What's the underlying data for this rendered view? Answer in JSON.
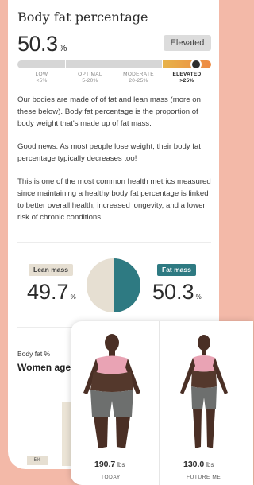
{
  "title": "Body fat percentage",
  "current": {
    "value": "50.3",
    "unit": "%",
    "status": "Elevated"
  },
  "scale": {
    "marker_fraction": 0.53,
    "ranges": [
      {
        "name": "LOW",
        "range": "<5%",
        "active": false
      },
      {
        "name": "OPTIMAL",
        "range": "5-20%",
        "active": false
      },
      {
        "name": "MODERATE",
        "range": "20-25%",
        "active": false
      },
      {
        "name": "ELEVATED",
        "range": ">25%",
        "active": true
      }
    ]
  },
  "paragraphs": [
    "Our bodies are made of of fat and lean mass (more on these below).  Body fat percentage is the proportion of body weight that's made up of fat mass.",
    "Good news: As most people lose weight, their body fat percentage typically decreases too!",
    "This is one of the most common health metrics measured since maintaining a healthy body fat percentage is linked to better overall health, increased longevity, and a lower risk of chronic conditions."
  ],
  "composition": {
    "lean": {
      "label": "Lean mass",
      "value": "49.7",
      "unit": "%"
    },
    "fat": {
      "label": "Fat mass",
      "value": "50.3",
      "unit": "%"
    }
  },
  "comparison": {
    "label": "Body fat %",
    "heading": "Women ages",
    "badge": "5%"
  },
  "projection": {
    "today": {
      "weight": "190.7",
      "unit": "lbs",
      "label": "TODAY"
    },
    "future": {
      "weight": "130.0",
      "unit": "lbs",
      "label": "FUTURE ME"
    }
  },
  "colors": {
    "background": "#f3b9a8",
    "accent_teal": "#2e7a82",
    "lean_beige": "#e6dfd2",
    "elevated_orange": "#ee8a44"
  }
}
